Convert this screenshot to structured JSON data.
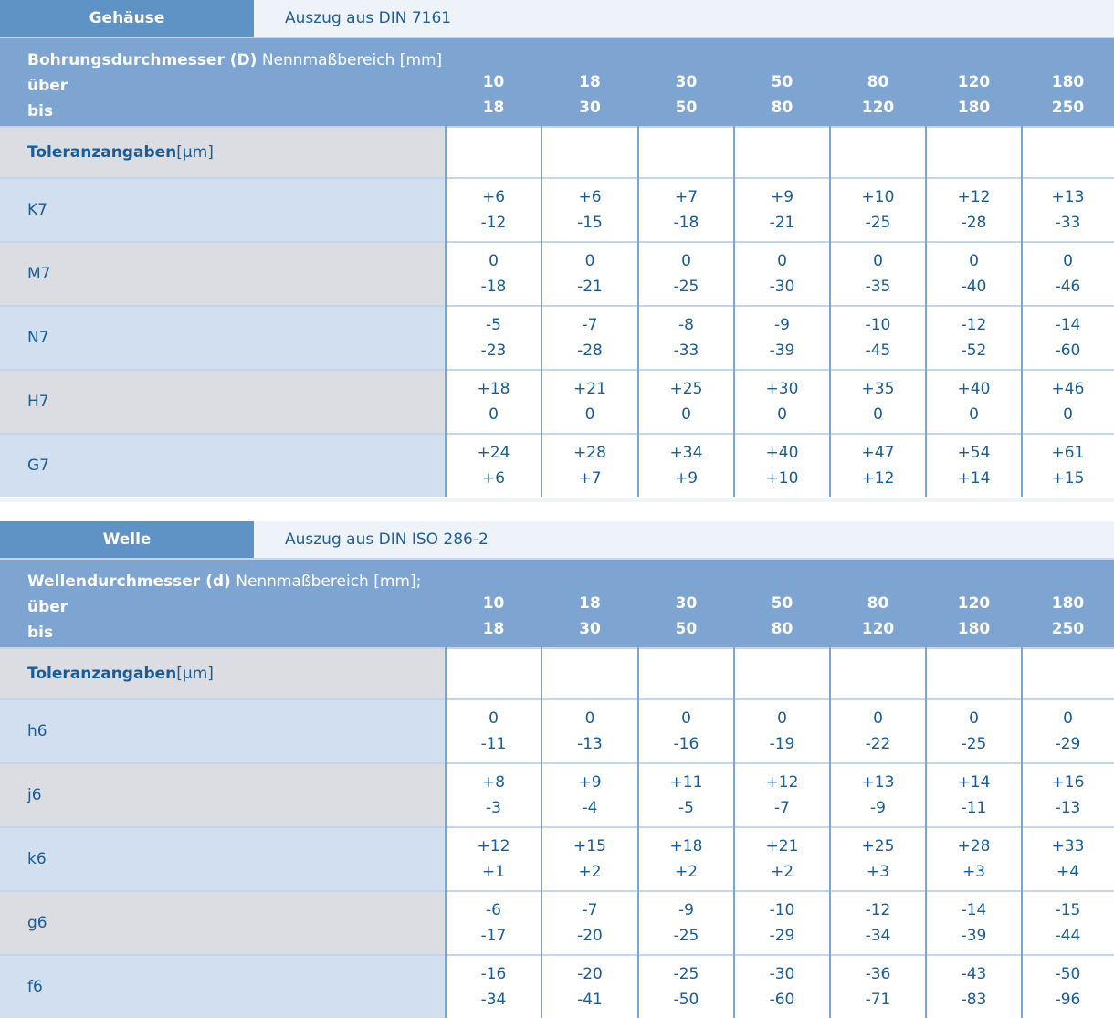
{
  "sections": [
    {
      "tab_label": "Gehäuse",
      "note": "Auszug aus DIN 7161",
      "header_bold": "Bohrungsdurchmesser (D)",
      "header_normal": " Nennmaßbereich [mm]",
      "row_over": "über",
      "row_to": "bis",
      "over": [
        "10",
        "18",
        "30",
        "50",
        "80",
        "120",
        "180"
      ],
      "to": [
        "18",
        "30",
        "50",
        "80",
        "120",
        "180",
        "250"
      ],
      "tol_bold": "Toleranzangaben",
      "tol_normal": " [µm]",
      "rows": [
        {
          "label": "K7",
          "upper": [
            "+6",
            "+6",
            "+7",
            "+9",
            "+10",
            "+12",
            "+13"
          ],
          "lower": [
            "-12",
            "-15",
            "-18",
            "-21",
            "-25",
            "-28",
            "-33"
          ]
        },
        {
          "label": "M7",
          "upper": [
            "0",
            "0",
            "0",
            "0",
            "0",
            "0",
            "0"
          ],
          "lower": [
            "-18",
            "-21",
            "-25",
            "-30",
            "-35",
            "-40",
            "-46"
          ]
        },
        {
          "label": "N7",
          "upper": [
            "-5",
            "-7",
            "-8",
            "-9",
            "-10",
            "-12",
            "-14"
          ],
          "lower": [
            "-23",
            "-28",
            "-33",
            "-39",
            "-45",
            "-52",
            "-60"
          ]
        },
        {
          "label": "H7",
          "upper": [
            "+18",
            "+21",
            "+25",
            "+30",
            "+35",
            "+40",
            "+46"
          ],
          "lower": [
            "0",
            "0",
            "0",
            "0",
            "0",
            "0",
            "0"
          ]
        },
        {
          "label": "G7",
          "upper": [
            "+24",
            "+28",
            "+34",
            "+40",
            "+47",
            "+54",
            "+61"
          ],
          "lower": [
            "+6",
            "+7",
            "+9",
            "+10",
            "+12",
            "+14",
            "+15"
          ]
        }
      ]
    },
    {
      "tab_label": "Welle",
      "note": "Auszug aus DIN ISO 286-2",
      "header_bold": "Wellendurchmesser (d)",
      "header_normal": " Nennmaßbereich [mm];",
      "row_over": "über",
      "row_to": "bis",
      "over": [
        "10",
        "18",
        "30",
        "50",
        "80",
        "120",
        "180"
      ],
      "to": [
        "18",
        "30",
        "50",
        "80",
        "120",
        "180",
        "250"
      ],
      "tol_bold": "Toleranzangaben",
      "tol_normal": " [µm]",
      "rows": [
        {
          "label": "h6",
          "upper": [
            "0",
            "0",
            "0",
            "0",
            "0",
            "0",
            "0"
          ],
          "lower": [
            "-11",
            "-13",
            "-16",
            "-19",
            "-22",
            "-25",
            "-29"
          ]
        },
        {
          "label": "j6",
          "upper": [
            "+8",
            "+9",
            "+11",
            "+12",
            "+13",
            "+14",
            "+16"
          ],
          "lower": [
            "-3",
            "-4",
            "-5",
            "-7",
            "-9",
            "-11",
            "-13"
          ]
        },
        {
          "label": "k6",
          "upper": [
            "+12",
            "+15",
            "+18",
            "+21",
            "+25",
            "+28",
            "+33"
          ],
          "lower": [
            "+1",
            "+2",
            "+2",
            "+2",
            "+3",
            "+3",
            "+4"
          ]
        },
        {
          "label": "g6",
          "upper": [
            "-6",
            "-7",
            "-9",
            "-10",
            "-12",
            "-14",
            "-15"
          ],
          "lower": [
            "-17",
            "-20",
            "-25",
            "-29",
            "-34",
            "-39",
            "-44"
          ]
        },
        {
          "label": "f6",
          "upper": [
            "-16",
            "-20",
            "-25",
            "-30",
            "-36",
            "-43",
            "-50"
          ],
          "lower": [
            "-34",
            "-41",
            "-50",
            "-60",
            "-71",
            "-83",
            "-96"
          ]
        }
      ]
    }
  ]
}
